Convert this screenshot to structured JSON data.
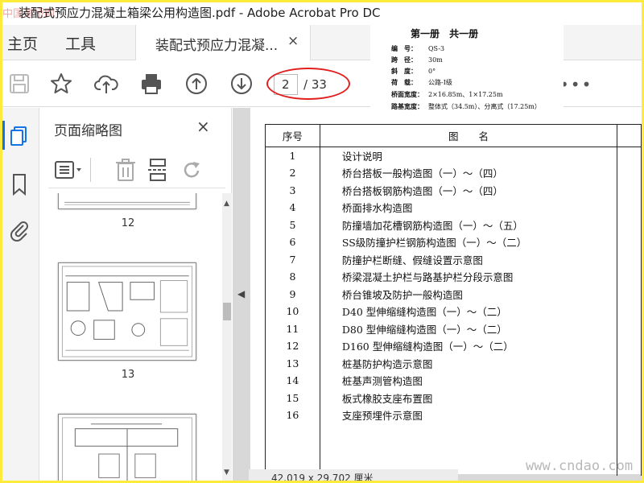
{
  "window": {
    "title": "装配式预应力混凝土箱梁公用构造图.pdf - Adobe Acrobat Pro DC",
    "watermark": "中国道桥网"
  },
  "menu": {
    "home": "主页",
    "tools": "工具"
  },
  "tab": {
    "label": "装配式预应力混凝...",
    "close": "×"
  },
  "toolbar": {
    "icons": [
      "save-icon",
      "star-icon",
      "cloud-upload-icon",
      "print-icon",
      "arrow-up-icon",
      "arrow-down-icon"
    ],
    "page_current": "2",
    "page_total": "/ 33",
    "more": "•••"
  },
  "panel": {
    "title": "页面缩略图",
    "close": "×",
    "thumbnails": [
      {
        "page": "12"
      },
      {
        "page": "13"
      },
      {
        "page": ""
      }
    ]
  },
  "info_box": {
    "heading": "第一册 共一册",
    "rows": [
      {
        "label": "编　号：",
        "value": "QS-3"
      },
      {
        "label": "跨　径：",
        "value": "30m"
      },
      {
        "label": "斜　度：",
        "value": "0°"
      },
      {
        "label": "荷　载：",
        "value": "公路-Ⅰ级"
      },
      {
        "label": "桥面宽度：",
        "value": "2×16.85m、1×17.25m"
      },
      {
        "label": "路基宽度：",
        "value": "整体式（34.5m）、分离式（17.25m）"
      }
    ]
  },
  "toc": {
    "headers": {
      "num": "序号",
      "name": "图　　名"
    },
    "rows": [
      {
        "num": "1",
        "name": "设计说明"
      },
      {
        "num": "2",
        "name": "桥台搭板一般构造图（一）～（四）"
      },
      {
        "num": "3",
        "name": "桥台搭板钢筋构造图（一）～（四）"
      },
      {
        "num": "4",
        "name": "桥面排水构造图"
      },
      {
        "num": "5",
        "name": "防撞墙加花槽钢筋构造图（一）～（五）"
      },
      {
        "num": "6",
        "name": "SS级防撞护栏钢筋构造图（一）～（二）"
      },
      {
        "num": "7",
        "name": "防撞护栏断缝、假缝设置示意图"
      },
      {
        "num": "8",
        "name": "桥梁混凝土护栏与路基护栏分段示意图"
      },
      {
        "num": "9",
        "name": "桥台锥坡及防护一般构造图"
      },
      {
        "num": "10",
        "name": "D40 型伸缩缝构造图（一）～（二）"
      },
      {
        "num": "11",
        "name": "D80 型伸缩缝构造图（一）～（二）"
      },
      {
        "num": "12",
        "name": "D160 型伸缩缝构造图（一）～（二）"
      },
      {
        "num": "13",
        "name": "桩基防护构造示意图"
      },
      {
        "num": "14",
        "name": "桩基声测管构造图"
      },
      {
        "num": "15",
        "name": "板式橡胶支座布置图"
      },
      {
        "num": "16",
        "name": "支座预埋件示意图"
      },
      {
        "num": "",
        "name": ""
      },
      {
        "num": "",
        "name": ""
      },
      {
        "num": "",
        "name": ""
      }
    ]
  },
  "status": {
    "page_size": "42.019 x 29.702 厘米"
  },
  "site_watermark": "www.cndao.com",
  "colors": {
    "accent": "#1473e6",
    "annotation": "#e02020",
    "frame": "#ffeb3b"
  }
}
